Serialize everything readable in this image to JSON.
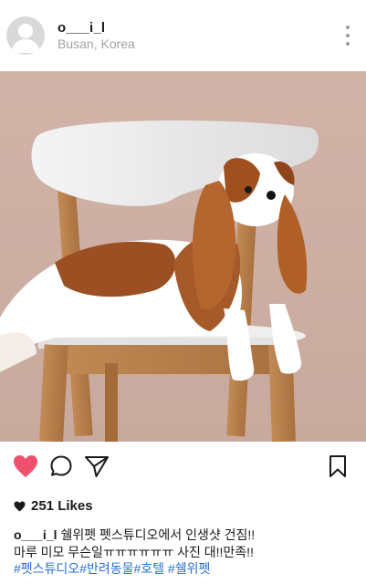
{
  "post": {
    "username": "o___i_l",
    "location": "Busan, Korea",
    "likes_count": "251",
    "likes_label": "Likes",
    "caption_line1": "쉘위펫 펫스튜디오에서 인생샷 건짐!!",
    "caption_line2": "마루 미모 무슨일ㅠㅠㅠㅠㅠㅠ 사진 대!!만족!!",
    "hashtags": "#펫스튜디오#반려동물#호텔 #쉘위펫",
    "liked": true
  },
  "icons": {
    "avatar": "default-user-avatar",
    "more": "vertical-ellipsis-icon",
    "like": "heart-filled-icon",
    "comment": "speech-bubble-icon",
    "share": "paper-plane-icon",
    "save": "bookmark-icon",
    "likes_heart": "small-heart-icon"
  },
  "colors": {
    "like_active": "#f0506e",
    "hashtag": "#2a6fd1",
    "location": "#a3a3a3"
  }
}
